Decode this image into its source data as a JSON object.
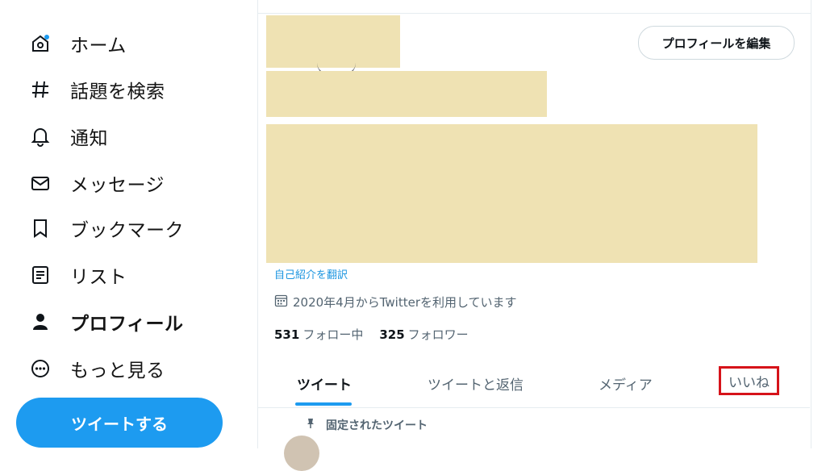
{
  "nav": {
    "items": [
      {
        "label": "ホーム",
        "icon": "home-icon"
      },
      {
        "label": "話題を検索",
        "icon": "hashtag-icon"
      },
      {
        "label": "通知",
        "icon": "bell-icon"
      },
      {
        "label": "メッセージ",
        "icon": "envelope-icon"
      },
      {
        "label": "ブックマーク",
        "icon": "bookmark-icon"
      },
      {
        "label": "リスト",
        "icon": "list-icon"
      },
      {
        "label": "プロフィール",
        "icon": "person-icon"
      },
      {
        "label": "もっと見る",
        "icon": "more-circle-icon"
      }
    ],
    "tweet_button": "ツイートする"
  },
  "profile": {
    "edit_button": "プロフィールを編集",
    "translate_bio": "自己紹介を翻訳",
    "joined": "2020年4月からTwitterを利用しています",
    "following_count": "531",
    "following_label": "フォロー中",
    "followers_count": "325",
    "followers_label": "フォロワー"
  },
  "tabs": [
    {
      "label": "ツイート"
    },
    {
      "label": "ツイートと返信"
    },
    {
      "label": "メディア"
    },
    {
      "label": "いいね"
    }
  ],
  "pinned": {
    "label": "固定されたツイート"
  },
  "colors": {
    "accent": "#1d9bf0",
    "redacted": "#efe2b3",
    "highlight_box": "#d6131a"
  }
}
